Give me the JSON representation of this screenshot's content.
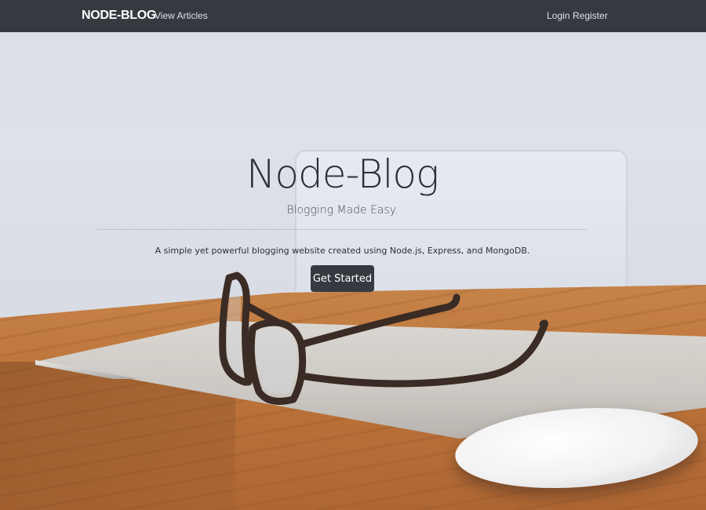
{
  "navbar": {
    "brand": "NODE-BLOG",
    "links": [
      {
        "label": "View Articles"
      }
    ],
    "right_links": [
      {
        "label": "Login"
      },
      {
        "label": "Register"
      }
    ],
    "background": "#343a40"
  },
  "hero": {
    "title": "Node-Blog",
    "subtitle": "Blogging Made Easy.",
    "lead": "A simple yet powerful blogging website created using Node.js, Express, and MongoDB.",
    "cta_label": "Get Started",
    "cta_color": "#343a40"
  },
  "background_image": {
    "icon": "desk-laptop-glasses-mouse-photo"
  }
}
